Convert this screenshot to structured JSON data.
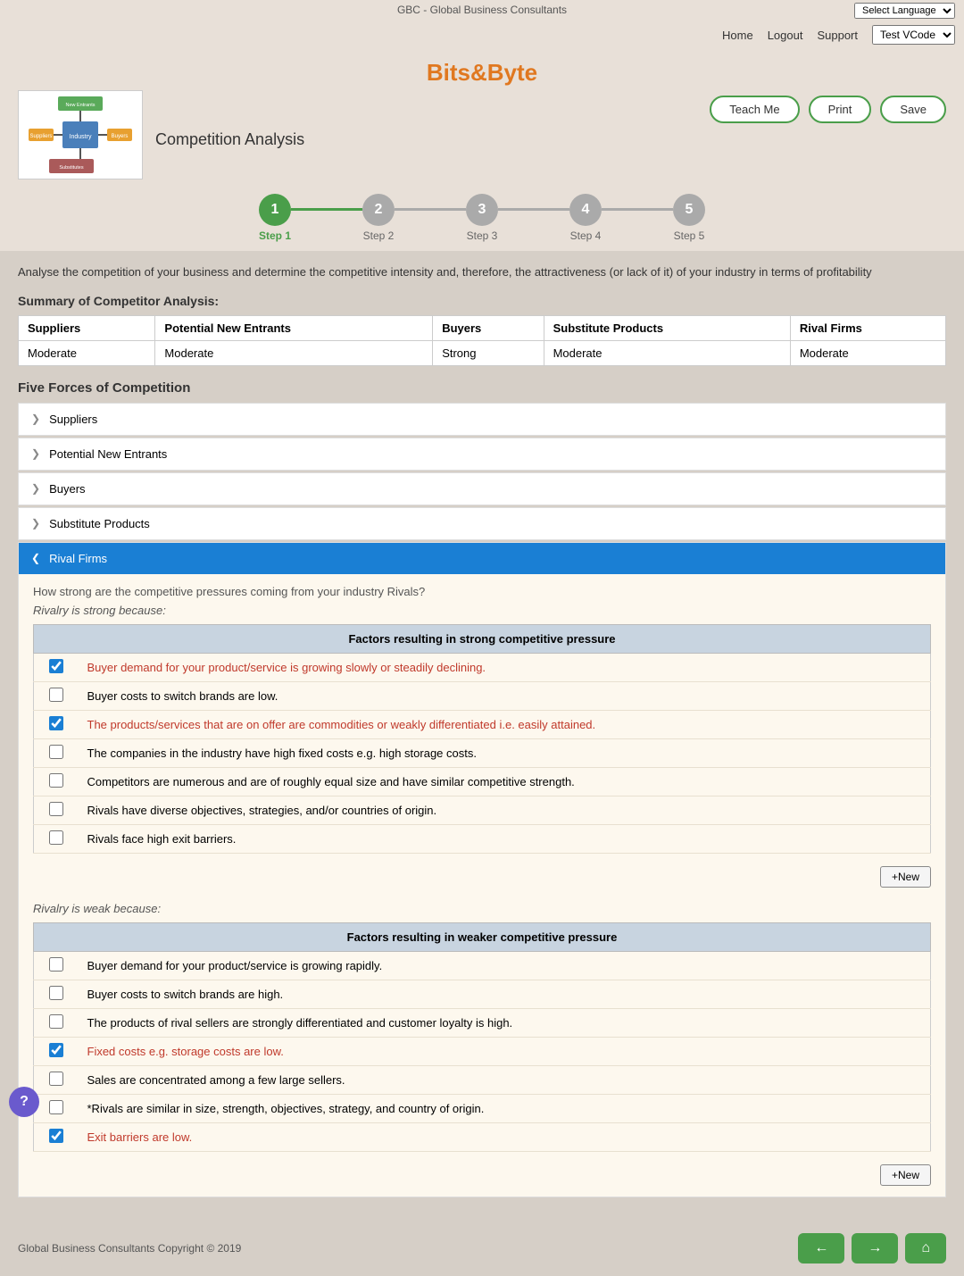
{
  "app": {
    "company": "GBC - Global Business Consultants",
    "brand": "Bits&Byte",
    "page_title": "Competition Analysis"
  },
  "topbar": {
    "company_label": "GBC - Global Business Consultants",
    "lang_label": "Select Language"
  },
  "navbar": {
    "home": "Home",
    "logout": "Logout",
    "support": "Support",
    "version": "Test VCode"
  },
  "header_buttons": {
    "teach_me": "Teach Me",
    "print": "Print",
    "save": "Save"
  },
  "steps": [
    {
      "number": "1",
      "label": "Step 1",
      "active": true
    },
    {
      "number": "2",
      "label": "Step 2",
      "active": false
    },
    {
      "number": "3",
      "label": "Step 3",
      "active": false
    },
    {
      "number": "4",
      "label": "Step 4",
      "active": false
    },
    {
      "number": "5",
      "label": "Step 5",
      "active": false
    }
  ],
  "intro": {
    "text": "Analyse the competition of your business and determine the competitive intensity and, therefore, the attractiveness (or lack of it) of your industry in terms of profitability"
  },
  "summary": {
    "title": "Summary of Competitor Analysis:",
    "columns": [
      "Suppliers",
      "Potential New Entrants",
      "Buyers",
      "Substitute Products",
      "Rival Firms"
    ],
    "values": [
      "Moderate",
      "Moderate",
      "Strong",
      "Moderate",
      "Moderate"
    ]
  },
  "five_forces": {
    "title": "Five Forces of Competition",
    "sections": [
      {
        "label": "Suppliers",
        "expanded": false
      },
      {
        "label": "Potential New Entrants",
        "expanded": false
      },
      {
        "label": "Buyers",
        "expanded": false
      },
      {
        "label": "Substitute Products",
        "expanded": false
      },
      {
        "label": "Rival Firms",
        "expanded": true
      }
    ]
  },
  "rival_firms": {
    "question": "How strong are the competitive pressures coming from your industry Rivals?",
    "strong_label": "Rivalry is strong because:",
    "weak_label": "Rivalry is weak because:",
    "strong_header": "Factors resulting in strong competitive pressure",
    "weak_header": "Factors resulting in weaker competitive pressure",
    "strong_factors": [
      {
        "checked": true,
        "text": "Buyer demand for your product/service is growing slowly or steadily declining."
      },
      {
        "checked": false,
        "text": "Buyer costs to switch brands are low."
      },
      {
        "checked": true,
        "text": "The products/services that are on offer are commodities or weakly differentiated i.e. easily attained."
      },
      {
        "checked": false,
        "text": "The companies in the industry have high fixed costs e.g. high storage costs."
      },
      {
        "checked": false,
        "text": "Competitors are numerous and are of roughly equal size and have similar competitive strength."
      },
      {
        "checked": false,
        "text": "Rivals have diverse objectives, strategies, and/or countries of origin."
      },
      {
        "checked": false,
        "text": "Rivals face high exit barriers."
      }
    ],
    "weak_factors": [
      {
        "checked": false,
        "text": "Buyer demand for your product/service is growing rapidly."
      },
      {
        "checked": false,
        "text": "Buyer costs to switch brands are high."
      },
      {
        "checked": false,
        "text": "The products of rival sellers are strongly differentiated and customer loyalty is high."
      },
      {
        "checked": true,
        "text": "Fixed costs e.g. storage costs are low."
      },
      {
        "checked": false,
        "text": "Sales are concentrated among a few large sellers."
      },
      {
        "checked": false,
        "text": "*Rivals are similar in size, strength, objectives, strategy, and country of origin."
      },
      {
        "checked": true,
        "text": "Exit barriers are low."
      }
    ],
    "new_btn": "+New"
  },
  "footer": {
    "copyright": "Global Business Consultants Copyright © 2019",
    "prev_icon": "←",
    "next_icon": "→",
    "home_icon": "⌂"
  }
}
